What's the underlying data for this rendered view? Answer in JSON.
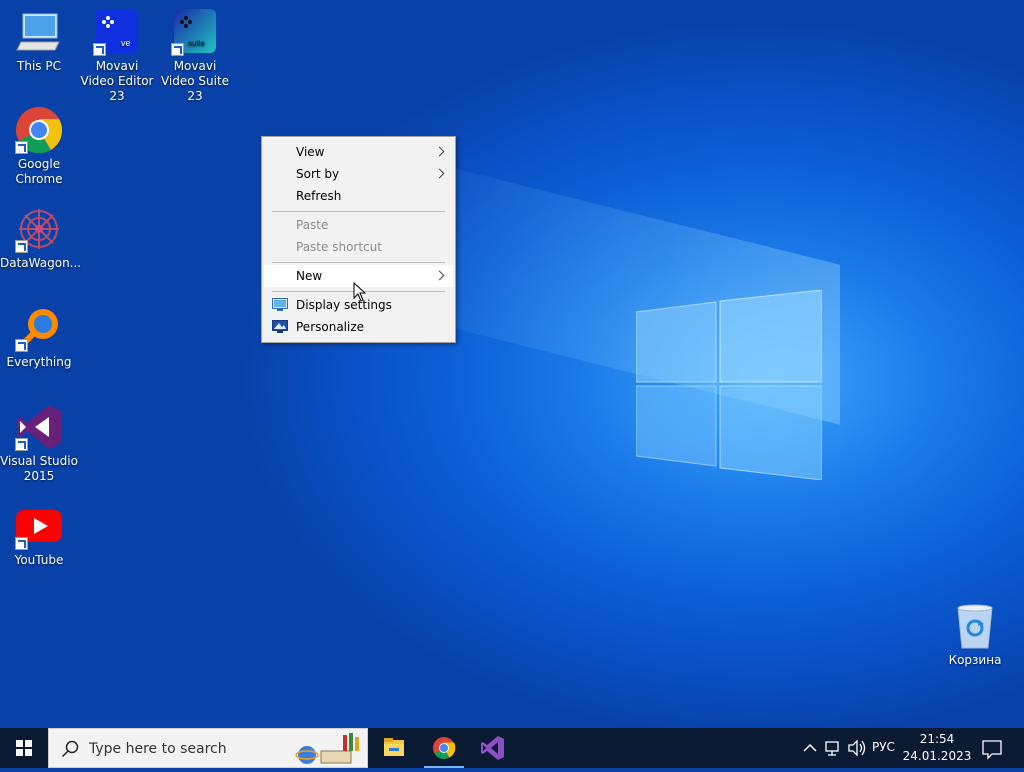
{
  "desktop": {
    "icons": [
      {
        "label": "This PC",
        "icon": "computer-icon"
      },
      {
        "label": "Movavi Video Editor 23",
        "icon": "movavi-editor-icon"
      },
      {
        "label": "Movavi Video Suite 23",
        "icon": "movavi-suite-icon"
      },
      {
        "label": "Google Chrome",
        "icon": "chrome-icon"
      },
      {
        "label": "DataWagon...",
        "icon": "datawagon-icon"
      },
      {
        "label": "Everything",
        "icon": "everything-icon"
      },
      {
        "label": "Visual Studio 2015",
        "icon": "visual-studio-icon"
      },
      {
        "label": "YouTube",
        "icon": "youtube-icon"
      },
      {
        "label": "Корзина",
        "icon": "recycle-bin-icon"
      }
    ],
    "movavi_editor_badge": "ve",
    "movavi_suite_badge": "suite"
  },
  "context_menu": {
    "view": "View",
    "sort_by": "Sort by",
    "refresh": "Refresh",
    "paste": "Paste",
    "paste_shortcut": "Paste shortcut",
    "new": "New",
    "display_settings": "Display settings",
    "personalize": "Personalize"
  },
  "taskbar": {
    "search_placeholder": "Type here to search",
    "language": "РУС",
    "time": "21:54",
    "date": "24.01.2023",
    "pinned": [
      "file-explorer-icon",
      "chrome-icon",
      "visual-studio-icon"
    ]
  },
  "colors": {
    "accent": "#0a5fd6",
    "taskbar": "#0b1a33"
  }
}
